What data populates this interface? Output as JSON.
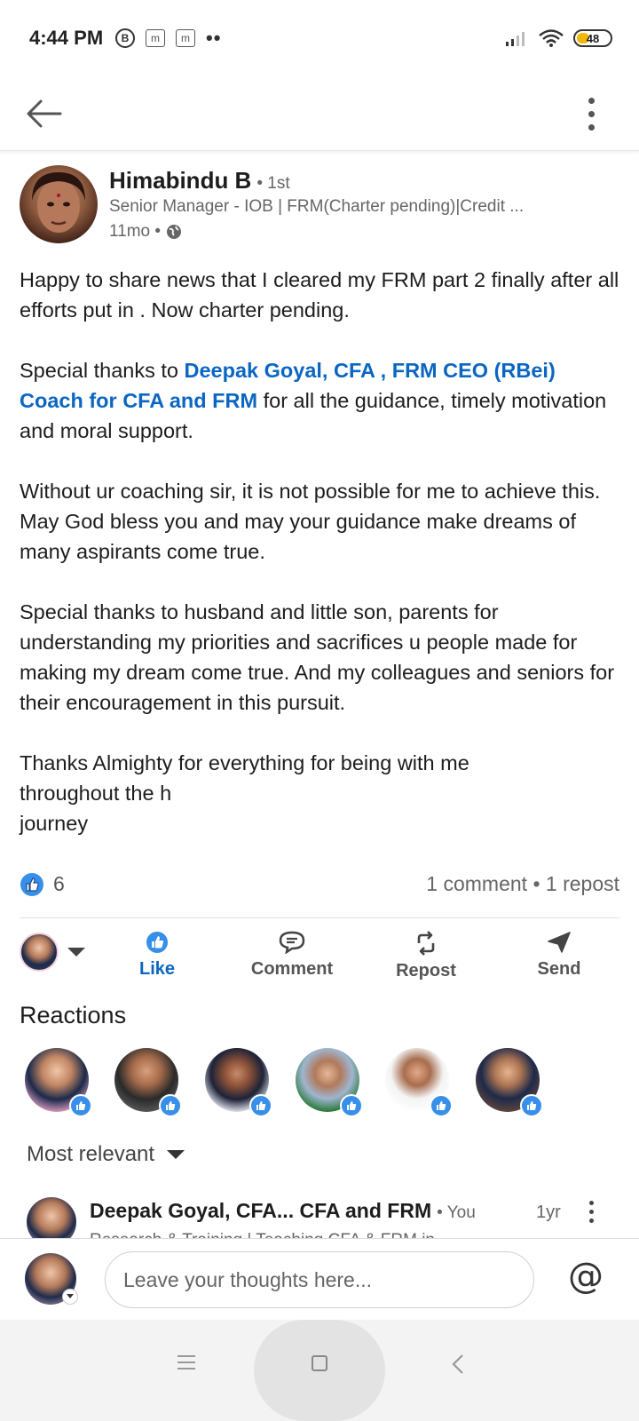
{
  "status_bar": {
    "time": "4:44 PM",
    "left_icons": [
      "B",
      "m",
      "m"
    ],
    "battery": "48",
    "battery_color": "#f2b705"
  },
  "header": {
    "back_icon": "arrow-left-icon",
    "more_icon": "vertical-dots-icon"
  },
  "post": {
    "author_name": "Himabindu B",
    "author_degree": "• 1st",
    "author_headline": "Senior Manager - IOB | FRM(Charter pending)|Credit ...",
    "time": "11mo •",
    "visibility_icon": "globe-icon",
    "p1": "Happy to share news that I cleared my FRM part 2 finally after all efforts put in . Now charter pending.",
    "p2_before": "Special thanks to ",
    "p2_mention": "Deepak Goyal, CFA , FRM  CEO (RBei) Coach for CFA and FRM",
    "p2_after": "  for all the guidance, timely motivation and moral support.",
    "p3": "Without ur coaching sir, it is not possible for me to achieve this. May God bless you and may your guidance make dreams of many aspirants come true.",
    "p4": "Special thanks to husband and little son, parents for understanding my priorities and sacrifices u people made for making my dream come true. And my colleagues and seniors for their encouragement in this pursuit.",
    "p5_line1": "Thanks Almighty for everything for being with me",
    "p5_line2": "throughout the h",
    "p5_line3": "journey",
    "mention_color": "#0a66c2"
  },
  "social": {
    "reaction_count": "6",
    "summary": "1 comment • 1 repost"
  },
  "actions": {
    "like": "Like",
    "comment": "Comment",
    "repost": "Repost",
    "send": "Send",
    "active_color": "#0a66c2"
  },
  "reactions": {
    "title": "Reactions",
    "count_shown": 6
  },
  "comments": {
    "sort_label": "Most relevant",
    "items": [
      {
        "name": "Deepak Goyal, CFA... CFA and FRM",
        "you": "• You",
        "time": "1yr",
        "headline": "Research & Training | Teaching CFA & FRM in..."
      }
    ]
  },
  "compose": {
    "placeholder": "Leave your thoughts here...",
    "mention_symbol": "@"
  }
}
